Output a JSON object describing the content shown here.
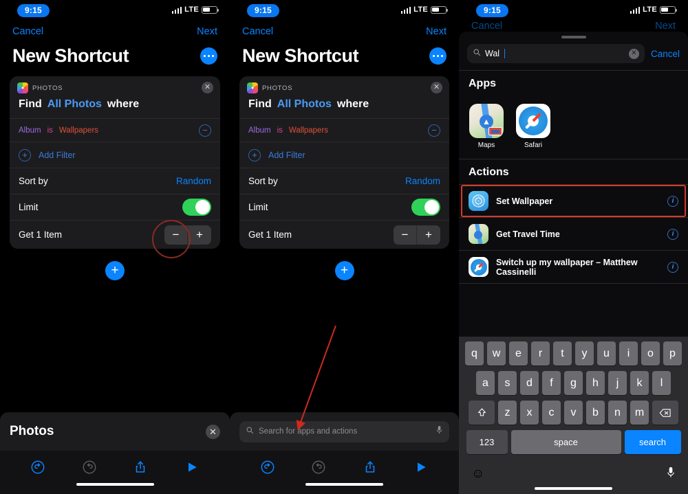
{
  "status_bar": {
    "time": "9:15",
    "network": "LTE",
    "signal_icon": "cellular-signal-icon",
    "battery_icon": "battery-icon"
  },
  "panel1": {
    "nav": {
      "cancel": "Cancel",
      "next": "Next"
    },
    "title": "New Shortcut",
    "more_icon": "ellipsis-icon",
    "card": {
      "app": "PHOTOS",
      "app_icon": "photos-app-icon",
      "close_icon": "close-icon",
      "find": {
        "verb": "Find",
        "object": "All Photos",
        "where": "where"
      },
      "filter": {
        "field": "Album",
        "operator": "is",
        "value": "Wallpapers",
        "remove_icon": "minus-circle-icon"
      },
      "add_filter": {
        "label": "Add Filter",
        "icon": "plus-circle-icon"
      },
      "sort": {
        "label": "Sort by",
        "value": "Random"
      },
      "limit": {
        "label": "Limit",
        "toggle_on": true
      },
      "get_items": {
        "label": "Get 1 Item",
        "minus_icon": "minus-icon",
        "plus_icon": "plus-icon"
      }
    },
    "add_action_icon": "plus-circle-button",
    "bottom_chip": {
      "label": "Photos",
      "close_icon": "close-icon"
    },
    "toolbar": {
      "undo_icon": "undo-icon",
      "redo_icon": "redo-icon",
      "share_icon": "share-icon",
      "play_icon": "play-icon"
    }
  },
  "panel2": {
    "nav": {
      "cancel": "Cancel",
      "next": "Next"
    },
    "title": "New Shortcut",
    "more_icon": "ellipsis-icon",
    "card": {
      "app": "PHOTOS",
      "app_icon": "photos-app-icon",
      "close_icon": "close-icon",
      "find": {
        "verb": "Find",
        "object": "All Photos",
        "where": "where"
      },
      "filter": {
        "field": "Album",
        "operator": "is",
        "value": "Wallpapers",
        "remove_icon": "minus-circle-icon"
      },
      "add_filter": {
        "label": "Add Filter",
        "icon": "plus-circle-icon"
      },
      "sort": {
        "label": "Sort by",
        "value": "Random"
      },
      "limit": {
        "label": "Limit",
        "toggle_on": true
      },
      "get_items": {
        "label": "Get 1 Item",
        "minus_icon": "minus-icon",
        "plus_icon": "plus-icon"
      }
    },
    "add_action_icon": "plus-circle-button",
    "search": {
      "placeholder": "Search for apps and actions",
      "search_icon": "search-icon",
      "mic_icon": "microphone-icon"
    },
    "toolbar": {
      "undo_icon": "undo-icon",
      "redo_icon": "redo-icon",
      "share_icon": "share-icon",
      "play_icon": "play-icon"
    }
  },
  "panel3": {
    "dim_nav": {
      "cancel": "Cancel",
      "next": "Next"
    },
    "grabber_icon": "sheet-grabber",
    "search": {
      "value": "Wal",
      "search_icon": "search-icon",
      "clear_icon": "clear-circle-icon",
      "cancel": "Cancel"
    },
    "apps_section": {
      "title": "Apps",
      "items": [
        {
          "label": "Maps",
          "icon": "maps-app-icon"
        },
        {
          "label": "Safari",
          "icon": "safari-app-icon"
        }
      ]
    },
    "actions_section": {
      "title": "Actions",
      "items": [
        {
          "label": "Set Wallpaper",
          "icon": "set-wallpaper-icon",
          "info_icon": "info-icon",
          "highlighted": true
        },
        {
          "label": "Get Travel Time",
          "icon": "maps-app-icon",
          "info_icon": "info-icon",
          "highlighted": false
        },
        {
          "label": "Switch up my wallpaper – Matthew Cassinelli",
          "icon": "safari-app-icon",
          "info_icon": "info-icon",
          "highlighted": false
        }
      ]
    },
    "keyboard": {
      "row1": [
        "q",
        "w",
        "e",
        "r",
        "t",
        "y",
        "u",
        "i",
        "o",
        "p"
      ],
      "row2": [
        "a",
        "s",
        "d",
        "f",
        "g",
        "h",
        "j",
        "k",
        "l"
      ],
      "row3": [
        "z",
        "x",
        "c",
        "v",
        "b",
        "n",
        "m"
      ],
      "shift_icon": "shift-icon",
      "backspace_icon": "backspace-icon",
      "numbers_key": "123",
      "space_key": "space",
      "search_key": "search",
      "emoji_icon": "emoji-icon",
      "mic_icon": "microphone-icon"
    }
  },
  "annotations": {
    "circle_highlight": {
      "target": "minus-stepper-button",
      "color": "#8a2a22"
    },
    "arrow": {
      "target": "search-bar",
      "color": "#cc2a1e"
    },
    "box_highlight": {
      "target": "set-wallpaper-row",
      "color": "#d63a2a"
    }
  }
}
